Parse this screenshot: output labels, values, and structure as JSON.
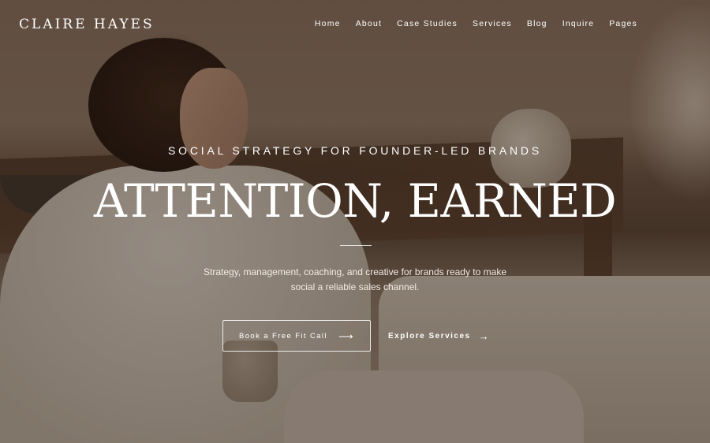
{
  "header": {
    "logo": "CLAIRE HAYES",
    "nav": [
      {
        "label": "Home"
      },
      {
        "label": "About"
      },
      {
        "label": "Case Studies"
      },
      {
        "label": "Services"
      },
      {
        "label": "Blog"
      },
      {
        "label": "Inquire"
      },
      {
        "label": "Pages"
      }
    ]
  },
  "hero": {
    "eyebrow": "SOCIAL STRATEGY FOR FOUNDER-LED BRANDS",
    "headline": "ATTENTION, EARNED",
    "subtext": "Strategy, management, coaching, and creative for brands ready to make social a reliable sales channel.",
    "primary_cta": "Book a Free Fit Call",
    "secondary_cta": "Explore Services",
    "arrow_icon": "long-arrow-right",
    "arrow_glyph": "⟶",
    "arrow_glyph_small": "→"
  },
  "colors": {
    "text": "#ffffff",
    "overlay": "rgba(28,18,12,0.38)"
  }
}
